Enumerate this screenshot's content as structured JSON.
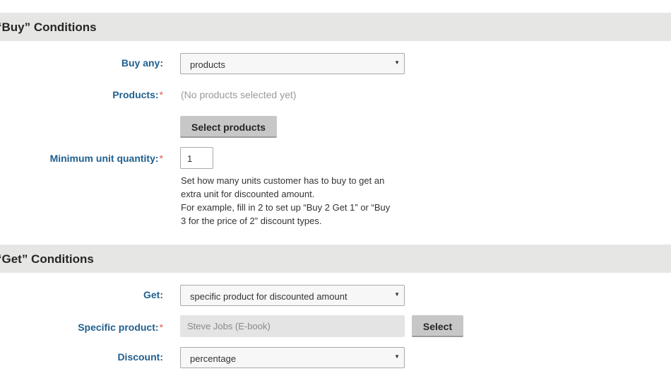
{
  "buy_section": {
    "title": "“Buy” Conditions",
    "buy_any": {
      "label": "Buy any:",
      "value": "products"
    },
    "products": {
      "label": "Products:",
      "required": "*",
      "empty_text": "(No products selected yet)",
      "button": "Select products"
    },
    "min_qty": {
      "label": "Minimum unit quantity:",
      "required": "*",
      "value": "1"
    },
    "help": [
      "Set how many units customer has to buy to get an",
      "extra unit for discounted amount.",
      "For example, fill in 2 to set up “Buy 2 Get 1” or “Buy",
      "3 for the price of 2” discount types."
    ]
  },
  "get_section": {
    "title": "“Get” Conditions",
    "get": {
      "label": "Get:",
      "value": "specific product for discounted amount"
    },
    "specific_product": {
      "label": "Specific product:",
      "required": "*",
      "value": "Steve Jobs (E-book)",
      "button": "Select"
    },
    "discount": {
      "label": "Discount:",
      "value": "percentage"
    }
  },
  "icons": {
    "dropdown_arrow": "▼"
  }
}
